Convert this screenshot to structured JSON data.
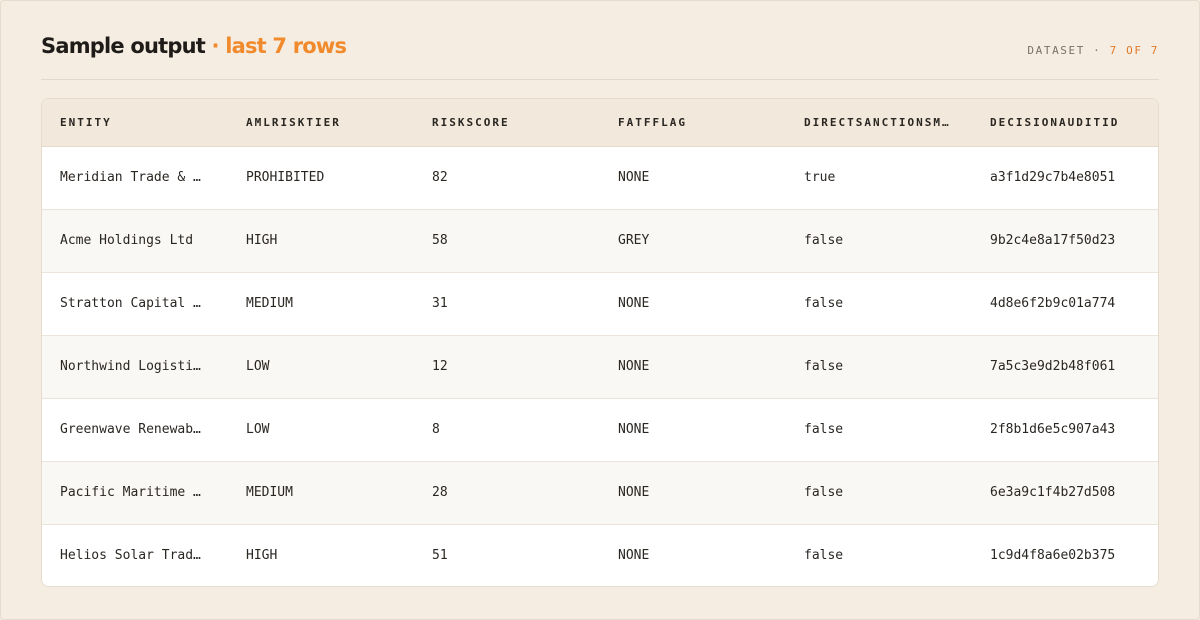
{
  "header": {
    "title": "Sample output",
    "title_accent": "· last 7 rows",
    "meta_label": "DATASET ·",
    "meta_count": "7 OF 7"
  },
  "table": {
    "columns": [
      "ENTITY",
      "AMLRISKTIER",
      "RISKSCORE",
      "FATFFLAG",
      "DIRECTSANCTIONSM…",
      "DECISIONAUDITID"
    ],
    "rows": [
      [
        "Meridian Trade & …",
        "PROHIBITED",
        "82",
        "NONE",
        "true",
        "a3f1d29c7b4e8051"
      ],
      [
        "Acme Holdings Ltd",
        "HIGH",
        "58",
        "GREY",
        "false",
        "9b2c4e8a17f50d23"
      ],
      [
        "Stratton Capital …",
        "MEDIUM",
        "31",
        "NONE",
        "false",
        "4d8e6f2b9c01a774"
      ],
      [
        "Northwind Logisti…",
        "LOW",
        "12",
        "NONE",
        "false",
        "7a5c3e9d2b48f061"
      ],
      [
        "Greenwave Renewab…",
        "LOW",
        "8",
        "NONE",
        "false",
        "2f8b1d6e5c907a43"
      ],
      [
        "Pacific Maritime …",
        "MEDIUM",
        "28",
        "NONE",
        "false",
        "6e3a9c1f4b27d508"
      ],
      [
        "Helios Solar Trad…",
        "HIGH",
        "51",
        "NONE",
        "false",
        "1c9d4f8a6e02b375"
      ]
    ]
  },
  "colors": {
    "background": "#f5ede2",
    "accent": "#f08a2c",
    "header_row": "#f2e9dc"
  }
}
